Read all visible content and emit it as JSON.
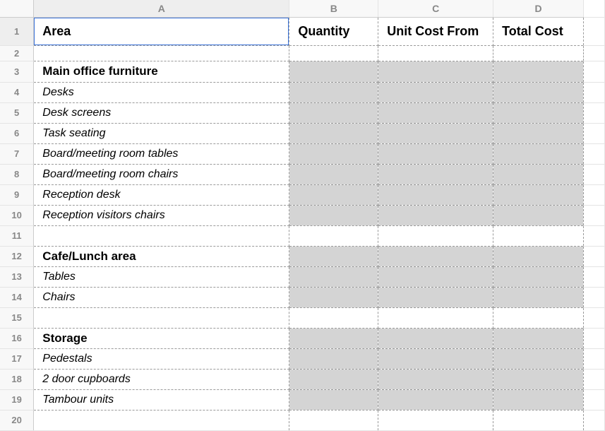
{
  "columns": [
    "A",
    "B",
    "C",
    "D"
  ],
  "header_row": {
    "A": "Area",
    "B": "Quantity",
    "C": "Unit Cost From",
    "D": "Total Cost"
  },
  "rows": [
    {
      "n": 1,
      "kind": "header",
      "A": "Area",
      "B": "Quantity",
      "C": "Unit Cost From",
      "D": "Total Cost",
      "shaded": false
    },
    {
      "n": 2,
      "kind": "blank",
      "A": "",
      "shaded": false
    },
    {
      "n": 3,
      "kind": "section",
      "A": "Main office furniture",
      "shaded": true
    },
    {
      "n": 4,
      "kind": "item",
      "A": "Desks",
      "shaded": true
    },
    {
      "n": 5,
      "kind": "item",
      "A": "Desk screens",
      "shaded": true
    },
    {
      "n": 6,
      "kind": "item",
      "A": "Task seating",
      "shaded": true
    },
    {
      "n": 7,
      "kind": "item",
      "A": "Board/meeting room tables",
      "shaded": true
    },
    {
      "n": 8,
      "kind": "item",
      "A": "Board/meeting room chairs",
      "shaded": true
    },
    {
      "n": 9,
      "kind": "item",
      "A": "Reception desk",
      "shaded": true
    },
    {
      "n": 10,
      "kind": "item",
      "A": "Reception visitors chairs",
      "shaded": true
    },
    {
      "n": 11,
      "kind": "blank",
      "A": "",
      "shaded": false
    },
    {
      "n": 12,
      "kind": "section",
      "A": "Cafe/Lunch area",
      "shaded": true
    },
    {
      "n": 13,
      "kind": "item",
      "A": "Tables",
      "shaded": true
    },
    {
      "n": 14,
      "kind": "item",
      "A": "Chairs",
      "shaded": true
    },
    {
      "n": 15,
      "kind": "blank",
      "A": "",
      "shaded": false
    },
    {
      "n": 16,
      "kind": "section",
      "A": "Storage",
      "shaded": true
    },
    {
      "n": 17,
      "kind": "item",
      "A": "Pedestals",
      "shaded": true
    },
    {
      "n": 18,
      "kind": "item",
      "A": "2 door cupboards",
      "shaded": true
    },
    {
      "n": 19,
      "kind": "item",
      "A": "Tambour units",
      "shaded": true
    },
    {
      "n": 20,
      "kind": "blank",
      "A": "",
      "shaded": false
    }
  ],
  "selected_cell": "A1",
  "chart_data": {
    "type": "table",
    "title": "",
    "columns": [
      "Area",
      "Quantity",
      "Unit Cost From",
      "Total Cost"
    ],
    "sections": [
      {
        "name": "Main office furniture",
        "items": [
          "Desks",
          "Desk screens",
          "Task seating",
          "Board/meeting room tables",
          "Board/meeting room chairs",
          "Reception desk",
          "Reception visitors chairs"
        ]
      },
      {
        "name": "Cafe/Lunch area",
        "items": [
          "Tables",
          "Chairs"
        ]
      },
      {
        "name": "Storage",
        "items": [
          "Pedestals",
          "2 door cupboards",
          "Tambour units"
        ]
      }
    ]
  }
}
